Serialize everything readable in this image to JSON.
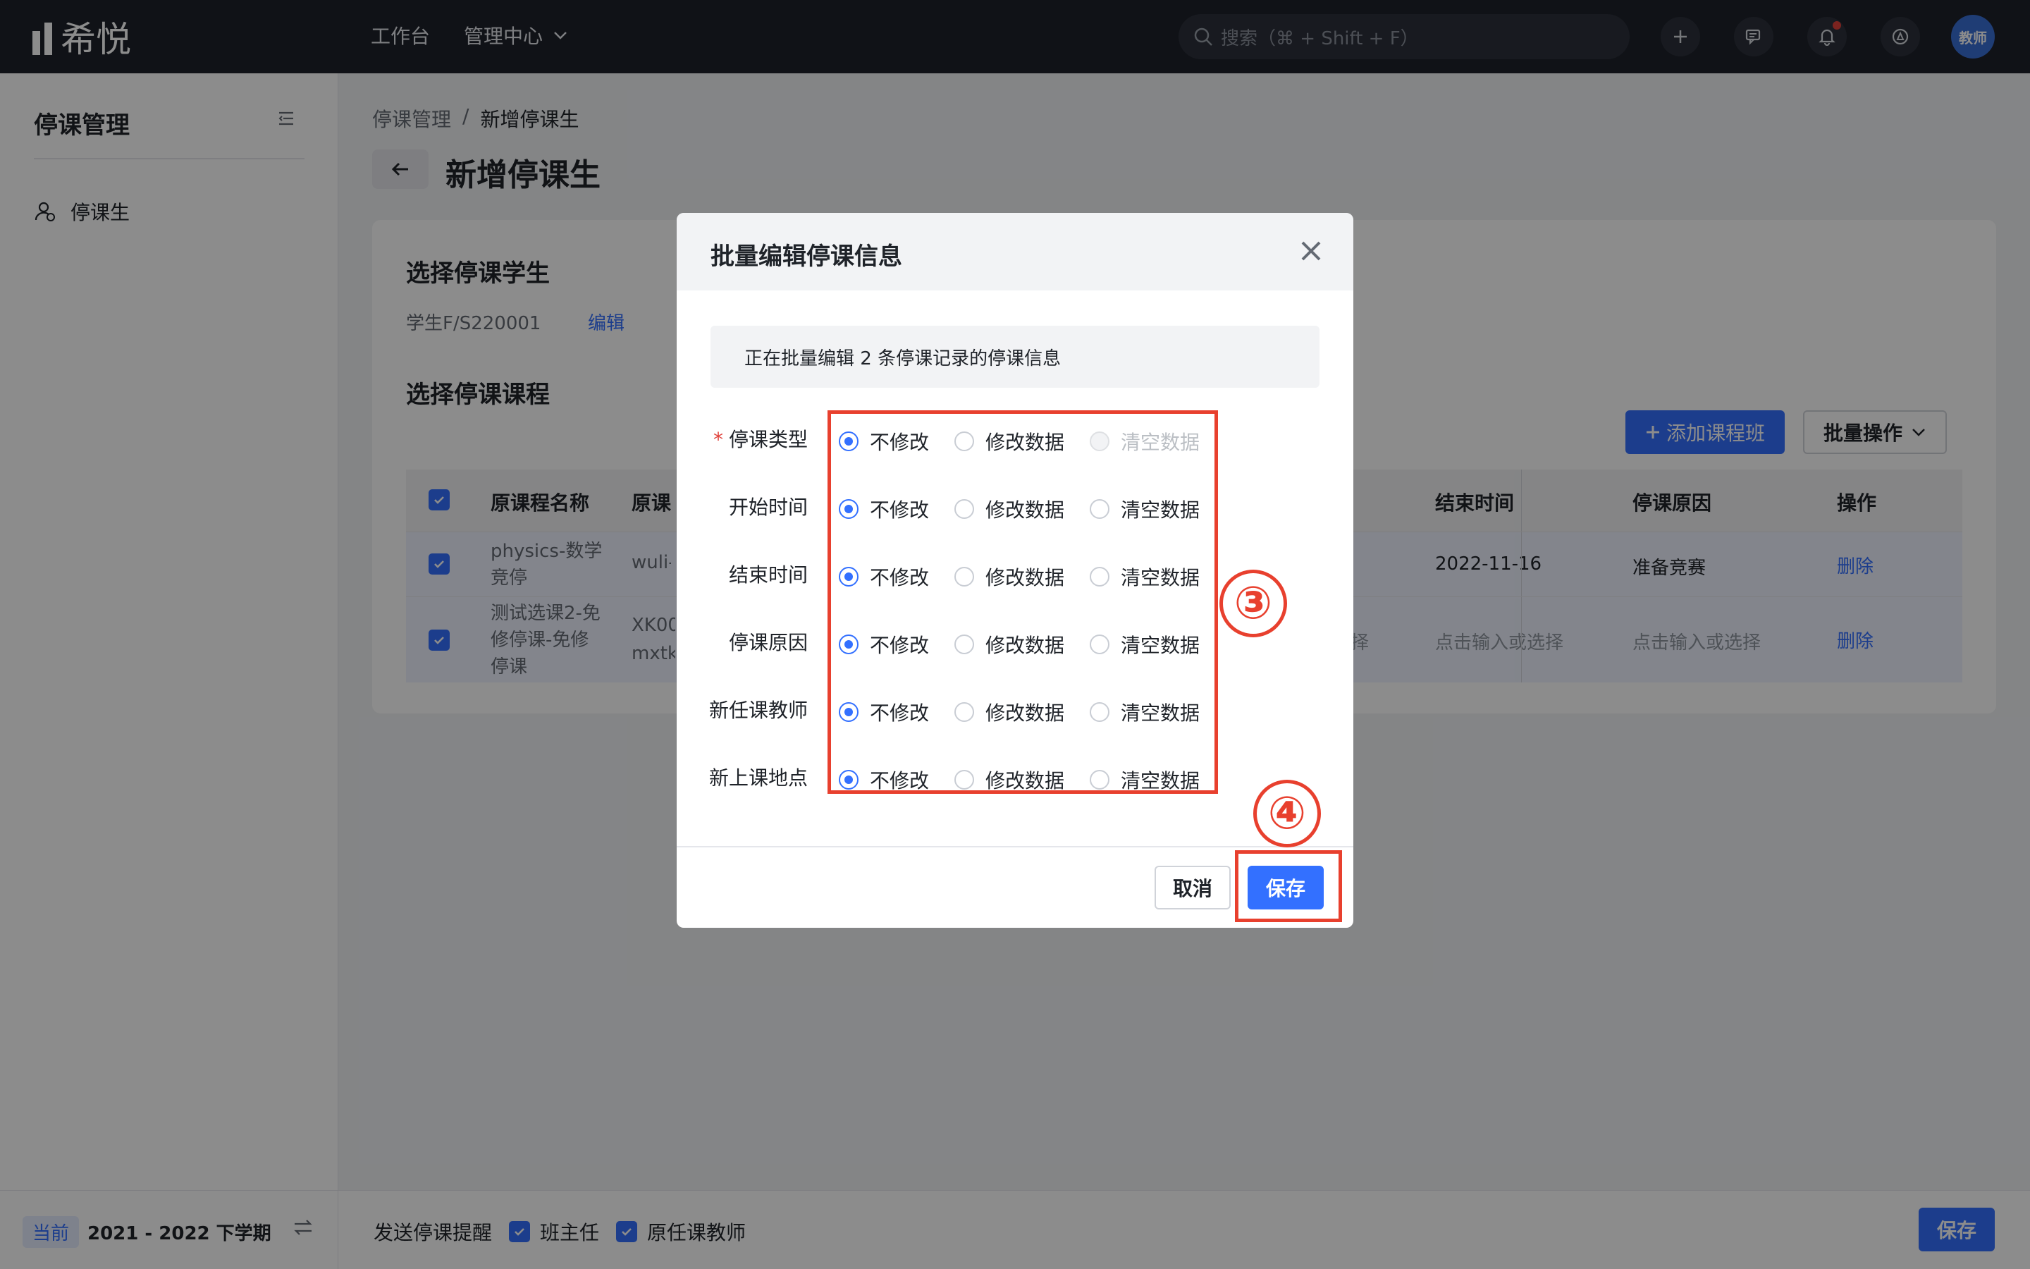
{
  "app": {
    "logo_text": "希悦",
    "nav": [
      {
        "label": "工作台"
      },
      {
        "label": "管理中心"
      }
    ],
    "search_placeholder": "搜索（⌘ + Shift + F）",
    "avatar_label": "教师"
  },
  "sidebar": {
    "title": "停课管理",
    "items": [
      {
        "label": "停课生"
      }
    ],
    "term_badge": "当前",
    "term": "2021 - 2022 下学期"
  },
  "page": {
    "breadcrumb": [
      "停课管理",
      "新增停课生"
    ],
    "breadcrumb_sep": "/",
    "title": "新增停课生",
    "section_student": "选择停课学生",
    "student": "学生F/S220001",
    "edit_link": "编辑",
    "section_course": "选择停课课程",
    "add_class_button": "添加课程班",
    "bulk_button": "批量操作"
  },
  "table": {
    "columns": [
      "原课程名称",
      "原课程班",
      "结束时间",
      "停课原因",
      "操作"
    ],
    "rows": [
      {
        "name": "physics-数学竞停",
        "class": "wuli-s",
        "left_tail": "",
        "end": "2022-11-16",
        "reason": "准备竞赛",
        "action": "删除"
      },
      {
        "name": "测试选课2-免修停课-免修停课",
        "class": "XK00 mxtk-",
        "left_tail": "择",
        "end": "点击输入或选择",
        "reason": "点击输入或选择",
        "action": "删除"
      }
    ]
  },
  "bottom": {
    "notify_label": "发送停课提醒",
    "options": [
      "班主任",
      "原任课教师"
    ],
    "save": "保存"
  },
  "modal": {
    "title": "批量编辑停课信息",
    "notice": "正在批量编辑 2 条停课记录的停课信息",
    "rows": [
      {
        "label": "停课类型",
        "required": true,
        "options": [
          "不修改",
          "修改数据",
          "清空数据"
        ],
        "selected": 0,
        "disabled": [
          2
        ]
      },
      {
        "label": "开始时间",
        "required": false,
        "options": [
          "不修改",
          "修改数据",
          "清空数据"
        ],
        "selected": 0,
        "disabled": []
      },
      {
        "label": "结束时间",
        "required": false,
        "options": [
          "不修改",
          "修改数据",
          "清空数据"
        ],
        "selected": 0,
        "disabled": []
      },
      {
        "label": "停课原因",
        "required": false,
        "options": [
          "不修改",
          "修改数据",
          "清空数据"
        ],
        "selected": 0,
        "disabled": []
      },
      {
        "label": "新任课教师",
        "required": false,
        "options": [
          "不修改",
          "修改数据",
          "清空数据"
        ],
        "selected": 0,
        "disabled": []
      },
      {
        "label": "新上课地点",
        "required": false,
        "options": [
          "不修改",
          "修改数据",
          "清空数据"
        ],
        "selected": 0,
        "disabled": []
      }
    ],
    "required_mark": "*",
    "cancel": "取消",
    "save": "保存"
  },
  "annotations": {
    "step3": "③",
    "step4": "④",
    "color": "#e8402e"
  }
}
